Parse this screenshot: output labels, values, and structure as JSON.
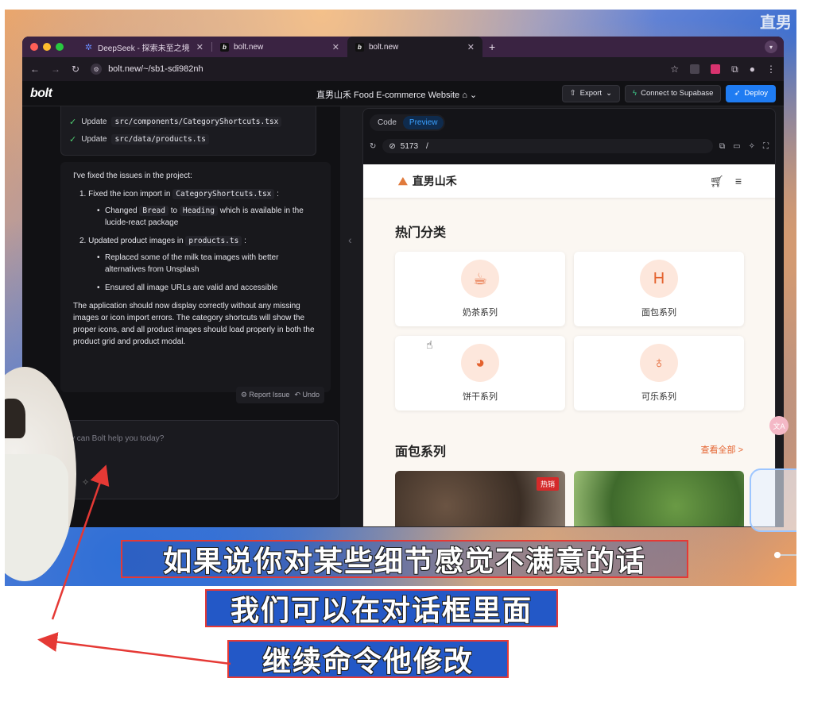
{
  "watermark": "直男",
  "browser": {
    "tabs": [
      {
        "title": "DeepSeek - 探索未至之境",
        "favicon": "deepseek-icon"
      },
      {
        "title": "bolt.new",
        "favicon": "b"
      },
      {
        "title": "bolt.new",
        "favicon": "b",
        "active": true
      }
    ],
    "url": "bolt.new/~/sb1-sdi982nh"
  },
  "bolt": {
    "logo": "bolt",
    "project_title": "直男山禾 Food E-commerce Website",
    "export_label": "Export",
    "supabase_label": "Connect to Supabase",
    "deploy_label": "Deploy"
  },
  "chat": {
    "steps": [
      {
        "verb": "Update",
        "file": "src/components/CategoryShortcuts.tsx"
      },
      {
        "verb": "Update",
        "file": "src/data/products.ts"
      }
    ],
    "intro": "I've fixed the issues in the project:",
    "item1_prefix": "1. Fixed the icon import in",
    "item1_code": "CategoryShortcuts.tsx",
    "item1_suffix": ":",
    "bullet1_a": "Changed",
    "bullet1_code1": "Bread",
    "bullet1_b": "to",
    "bullet1_code2": "Heading",
    "bullet1_c": "which is available in the lucide-react package",
    "item2_prefix": "2. Updated product images in",
    "item2_code": "products.ts",
    "item2_suffix": ":",
    "bullet2": "Replaced some of the milk tea images with better alternatives from Unsplash",
    "bullet3": "Ensured all image URLs are valid and accessible",
    "outro": "The application should now display correctly without any missing images or icon import errors. The category shortcuts will show the proper icons, and all product images should load properly in both the product grid and product modal.",
    "report_issue": "Report Issue",
    "undo": "Undo",
    "prompt_placeholder": "y can Bolt help you today?"
  },
  "preview": {
    "tab_code": "Code",
    "tab_preview": "Preview",
    "port": "5173",
    "path": "/"
  },
  "site": {
    "brand": "直男山禾",
    "section1_title": "热门分类",
    "categories": [
      {
        "label": "奶茶系列",
        "icon": "cup-icon"
      },
      {
        "label": "面包系列",
        "icon": "heading-icon"
      },
      {
        "label": "饼干系列",
        "icon": "cookie-icon"
      },
      {
        "label": "可乐系列",
        "icon": "wine-icon"
      }
    ],
    "section2_title": "面包系列",
    "view_all": "查看全部 >",
    "hot_badge": "热销"
  },
  "subtitles": {
    "line1": "如果说你对某些细节感觉不满意的话",
    "line2": "我们可以在对话框里面",
    "line3": "继续命令他修改"
  },
  "colors": {
    "bolt_blue": "#1f7cf2",
    "accent_orange": "#e4622e",
    "subtitle_box_red": "#e53935"
  }
}
